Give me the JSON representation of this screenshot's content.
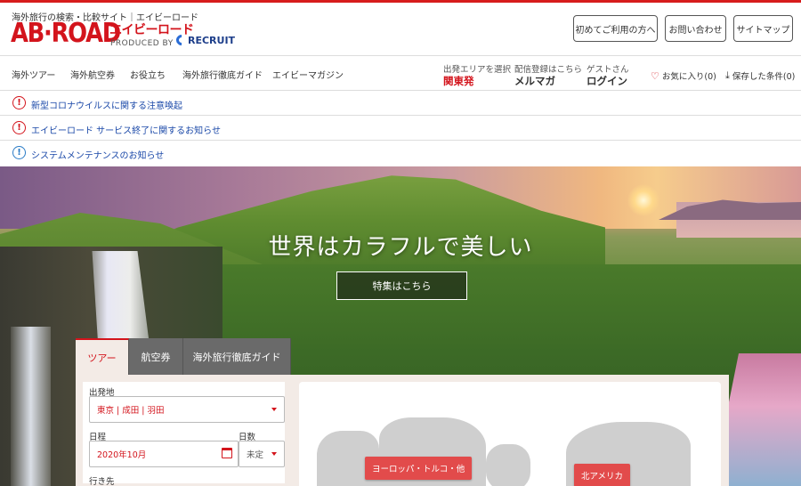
{
  "header": {
    "tagline": "海外旅行の検索・比較サイト｜エイビーロード",
    "logo_main": "AB·ROAD",
    "logo_kana": "エイビーロード",
    "logo_produced": "PRODUCED BY",
    "logo_recruit": "RECRUIT",
    "buttons": {
      "first_time": "初めてご利用の方へ",
      "contact": "お問い合わせ",
      "sitemap": "サイトマップ"
    }
  },
  "nav": {
    "items": [
      "海外ツアー",
      "海外航空券",
      "お役立ち",
      "海外旅行徹底ガイド",
      "エイビーマガジン"
    ],
    "departure": {
      "label": "出発エリアを選択",
      "value": "関東発"
    },
    "mailmag": {
      "label": "配信登録はこちら",
      "value": "メルマガ"
    },
    "guest": {
      "label": "ゲストさん",
      "value": "ログイン"
    },
    "favorites": "お気に入り(0)",
    "saved": "保存した条件(0)"
  },
  "notices": [
    {
      "text": "新型コロナウイルスに関する注意喚起",
      "type": "warning"
    },
    {
      "text": "エイビーロード サービス終了に関するお知らせ",
      "type": "warning"
    },
    {
      "text": "システムメンテナンスのお知らせ",
      "type": "info"
    }
  ],
  "hero": {
    "title": "世界はカラフルで美しい",
    "cta": "特集はこちら"
  },
  "search": {
    "tabs": [
      "ツアー",
      "航空券",
      "海外旅行徹底ガイド"
    ],
    "active_tab": "ツアー",
    "departure_label": "出発地",
    "departure_value": "東京 | 成田 | 羽田",
    "date_label": "日程",
    "date_value": "2020年10月",
    "days_label": "日数",
    "days_value": "未定",
    "destination_label": "行き先"
  },
  "map": {
    "regions": [
      "ヨーロッパ・トルコ・他",
      "北アメリカ"
    ]
  },
  "colors": {
    "brand_red": "#d3141c",
    "link_blue": "#1a48a8",
    "tab_gray": "#6a6a6a",
    "region_red": "#e24b4b"
  }
}
